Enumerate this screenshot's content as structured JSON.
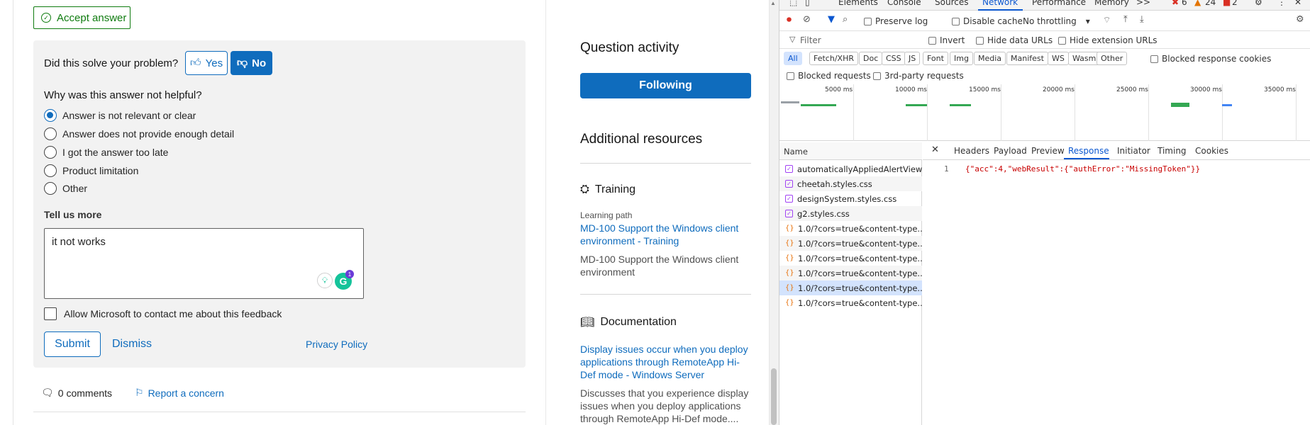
{
  "answer": {
    "accept_label": "Accept answer"
  },
  "feedback": {
    "question": "Did this solve your problem?",
    "yes_label": "Yes",
    "no_label": "No",
    "why_label": "Why was this answer not helpful?",
    "options": [
      {
        "label": "Answer is not relevant or clear",
        "selected": true
      },
      {
        "label": "Answer does not provide enough detail",
        "selected": false
      },
      {
        "label": "I got the answer too late",
        "selected": false
      },
      {
        "label": "Product limitation",
        "selected": false
      },
      {
        "label": "Other",
        "selected": false
      }
    ],
    "tell_more_label": "Tell us more",
    "textarea_value": "it not works",
    "grammarly_badge": "1",
    "contact_label": "Allow Microsoft to contact me about this feedback",
    "submit_label": "Submit",
    "dismiss_label": "Dismiss",
    "privacy_label": "Privacy Policy"
  },
  "footer": {
    "comments_label": "0 comments",
    "report_label": "Report a concern"
  },
  "sidebar": {
    "activity_title": "Question activity",
    "following_label": "Following",
    "resources_title": "Additional resources",
    "training_title": "Training",
    "learning_path_label": "Learning path",
    "training_link": "MD-100 Support the Windows client environment - Training",
    "training_desc": "MD-100 Support the Windows client environment",
    "documentation_title": "Documentation",
    "doc_link": "Display issues occur when you deploy applications through RemoteApp Hi-Def mode - Windows Server",
    "doc_desc": "Discusses that you experience display issues when you deploy applications through RemoteApp Hi-Def mode...."
  },
  "devtools": {
    "tabs": [
      "Elements",
      "Console",
      "Sources",
      "Network",
      "Performance",
      "Memory"
    ],
    "active_tab": "Network",
    "more_tabs": ">>",
    "errors": "6",
    "warnings": "24",
    "issues": "2",
    "toolbar": {
      "preserve_log": "Preserve log",
      "disable_cache": "Disable cache",
      "throttling": "No throttling"
    },
    "filter": {
      "placeholder": "Filter",
      "invert": "Invert",
      "hide_data_urls": "Hide data URLs",
      "hide_extension_urls": "Hide extension URLs"
    },
    "type_filters": [
      "All",
      "Fetch/XHR",
      "Doc",
      "CSS",
      "JS",
      "Font",
      "Img",
      "Media",
      "Manifest",
      "WS",
      "Wasm",
      "Other"
    ],
    "blocked_cookies": "Blocked response cookies",
    "blocked_requests": "Blocked requests",
    "third_party": "3rd-party requests",
    "timeline_ticks": [
      "5000 ms",
      "10000 ms",
      "15000 ms",
      "20000 ms",
      "25000 ms",
      "30000 ms",
      "35000 ms"
    ],
    "name_header": "Name",
    "requests": [
      {
        "name": "automaticallyAppliedAlertView...",
        "type": "css"
      },
      {
        "name": "cheetah.styles.css",
        "type": "css"
      },
      {
        "name": "designSystem.styles.css",
        "type": "css"
      },
      {
        "name": "g2.styles.css",
        "type": "css"
      },
      {
        "name": "1.0/?cors=true&content-type...",
        "type": "xhr"
      },
      {
        "name": "1.0/?cors=true&content-type...",
        "type": "xhr"
      },
      {
        "name": "1.0/?cors=true&content-type...",
        "type": "xhr"
      },
      {
        "name": "1.0/?cors=true&content-type...",
        "type": "xhr"
      },
      {
        "name": "1.0/?cors=true&content-type...",
        "type": "xhr"
      },
      {
        "name": "1.0/?cors=true&content-type...",
        "type": "xhr"
      }
    ],
    "selected_request_index": 8,
    "detail_tabs": [
      "Headers",
      "Payload",
      "Preview",
      "Response",
      "Initiator",
      "Timing",
      "Cookies"
    ],
    "active_detail_tab": "Response",
    "response_line_number": "1",
    "response_body": "{\"acc\":4,\"webResult\":{\"authError\":\"MissingToken\"}}"
  },
  "colors": {
    "accent": "#0f6cbd",
    "success": "#107c10",
    "devtools_blue": "#0b57d0"
  }
}
